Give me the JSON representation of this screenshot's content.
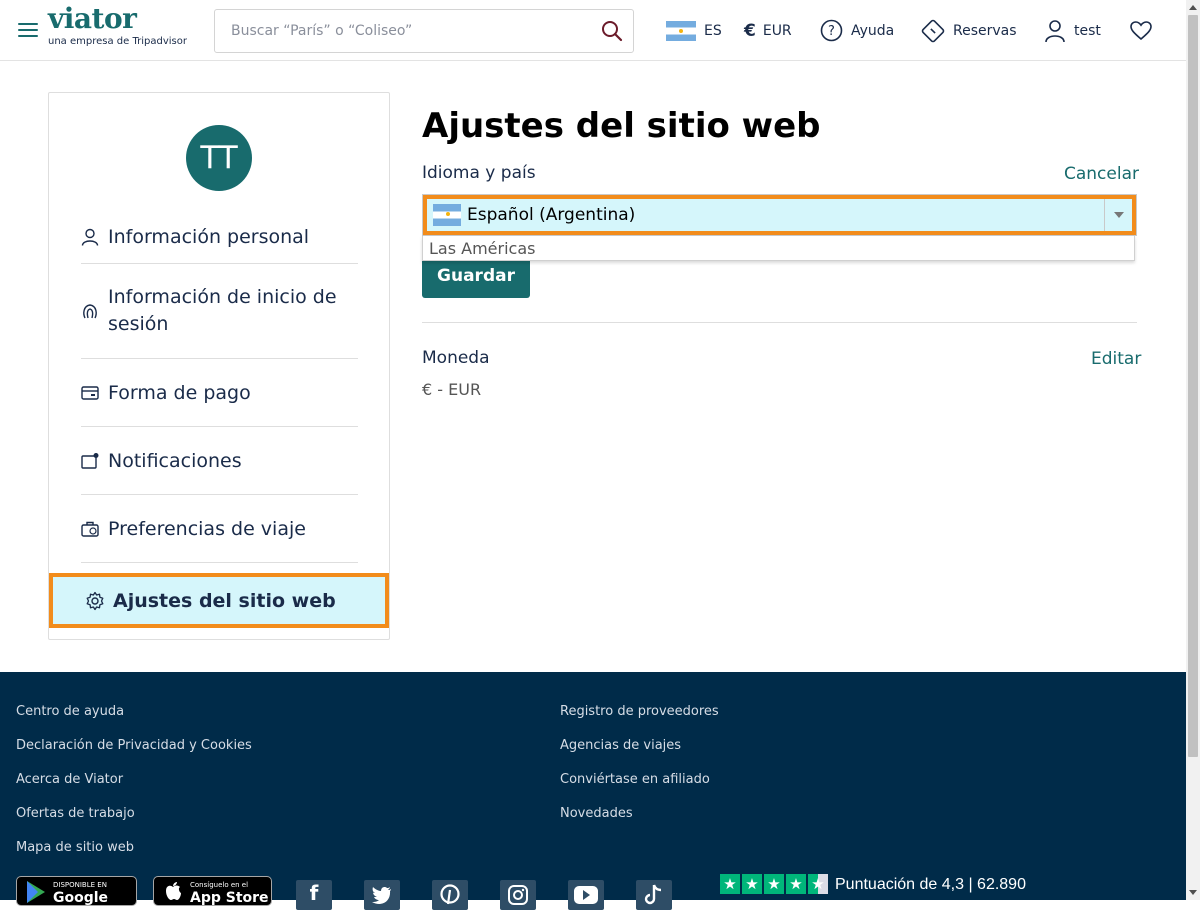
{
  "header": {
    "logo": "viator",
    "logo_sub": "una empresa de Tripadvisor",
    "search_placeholder": "Buscar “París” o “Coliseo”",
    "language": "ES",
    "currency": "EUR",
    "help": "Ayuda",
    "bookings": "Reservas",
    "user": "test"
  },
  "sidebar": {
    "avatar_initials": "TT",
    "items": [
      {
        "label": "Información personal",
        "icon": "user-icon"
      },
      {
        "label": "Información de inicio de sesión",
        "icon": "fingerprint-icon"
      },
      {
        "label": "Forma de pago",
        "icon": "credit-card-icon"
      },
      {
        "label": "Notificaciones",
        "icon": "notification-icon"
      },
      {
        "label": "Preferencias de viaje",
        "icon": "luggage-icon"
      }
    ],
    "active_item": {
      "label": "Ajustes del sitio web",
      "icon": "gear-icon"
    }
  },
  "main": {
    "title": "Ajustes del sitio web",
    "language_label": "Idioma y país",
    "cancel": "Cancelar",
    "selected_language": "Español (Argentina)",
    "dropdown_option": "Las Américas",
    "save": "Guardar",
    "currency_label": "Moneda",
    "edit": "Editar",
    "currency_value": "€ - EUR"
  },
  "footer": {
    "col1": [
      "Centro de ayuda",
      "Declaración de Privacidad y Cookies",
      "Acerca de Viator",
      "Ofertas de trabajo",
      "Mapa de sitio web"
    ],
    "col2": [
      "Registro de proveedores",
      "Agencias de viajes",
      "Conviértase en afiliado",
      "Novedades"
    ],
    "google_play_top": "DISPONIBLE EN",
    "google_play": "Google Play",
    "app_store_top": "Consíguelo en el",
    "app_store": "App Store",
    "social": [
      "facebook-icon",
      "twitter-icon",
      "pinterest-icon",
      "instagram-icon",
      "youtube-icon",
      "tiktok-icon"
    ],
    "rating_text": "Puntuación de 4,3  | 62.890",
    "rating_stars": 4.3
  },
  "colors": {
    "brand": "#186b6d",
    "highlight": "#f28c1b",
    "active_bg": "#d5f6fb",
    "footer_bg": "#002b49"
  }
}
